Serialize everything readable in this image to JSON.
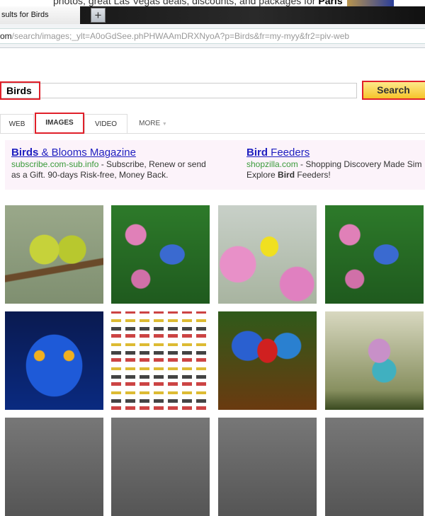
{
  "browser": {
    "top_text": "photos, great Las Vegas deals, discounts, and packages for",
    "top_text_bold": "Paris",
    "tab_title": "sults for Birds",
    "new_tab": "+",
    "url_host": "om",
    "url_path": "/search/images;_ylt=A0oGdSee.phPHWAAmDRXNyoA?p=Birds&fr=my-myy&fr2=piv-web"
  },
  "search": {
    "query": "Birds",
    "button": "Search"
  },
  "tabs": [
    {
      "label": "WEB"
    },
    {
      "label": "IMAGES",
      "active": true
    },
    {
      "label": "VIDEO"
    },
    {
      "label": "MORE",
      "icon": "caret-down-icon"
    }
  ],
  "ads": [
    {
      "title_bold": "Birds",
      "title_rest": " & Blooms Magazine",
      "domain": "subscribe.com-sub.info",
      "line1": " - Subscribe, Renew or send",
      "line2": "as a Gift. 90-days Risk-free, Money Back."
    },
    {
      "title_bold": "Bird",
      "title_rest": " Feeders",
      "domain": "shopzilla.com",
      "line1": " - Shopping Discovery Made Sim",
      "line2a": "Explore ",
      "line2b": "Bird",
      "line2c": " Feeders!"
    }
  ],
  "highlight_color": "#e0202a",
  "images": [
    "lovebirds",
    "blue-jay-blossoms",
    "goldfinch-blossoms",
    "blue-jay-blossoms",
    "blue-owl",
    "bird-chart",
    "scarlet-macaw",
    "lilac-breasted-roller",
    "bird",
    "bird",
    "bird",
    "bird"
  ]
}
